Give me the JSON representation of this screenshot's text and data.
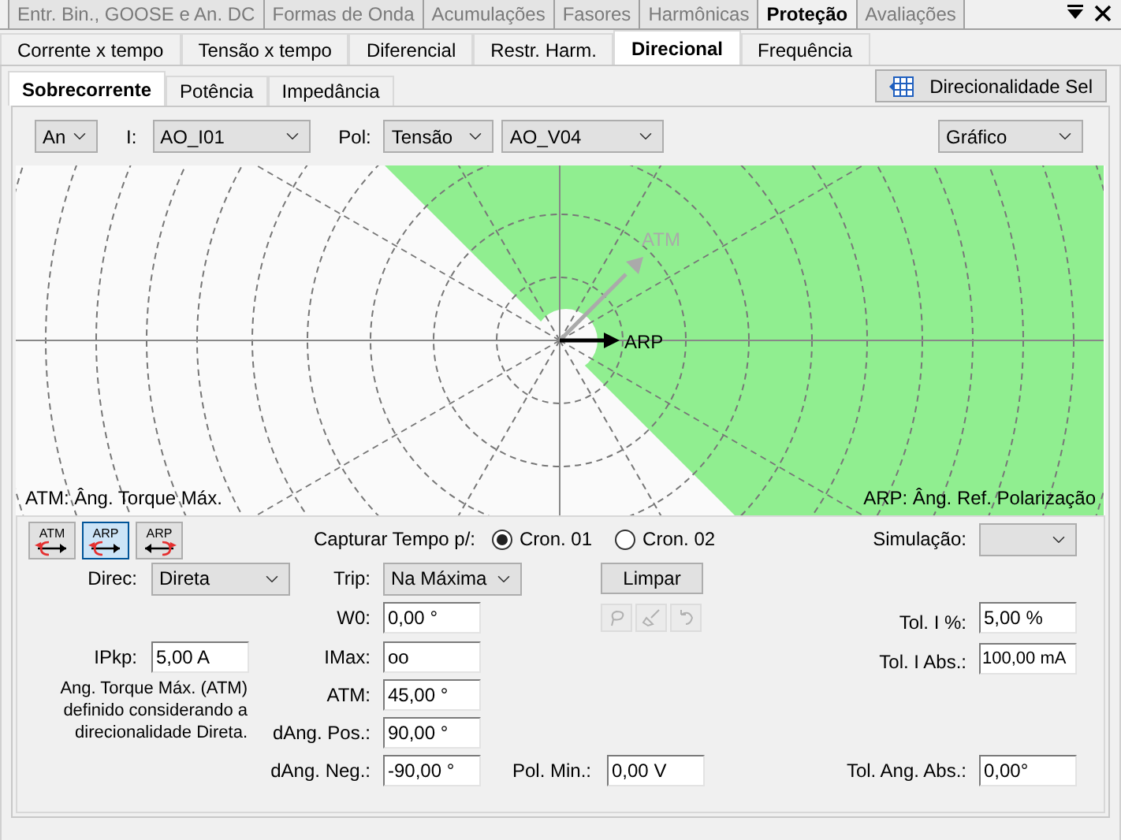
{
  "top_tabs": [
    {
      "label": "Entr. Bin., GOOSE e An. DC",
      "selected": false
    },
    {
      "label": "Formas de Onda",
      "selected": false
    },
    {
      "label": "Acumulações",
      "selected": false
    },
    {
      "label": "Fasores",
      "selected": false
    },
    {
      "label": "Harmônicas",
      "selected": false
    },
    {
      "label": "Proteção",
      "selected": true
    },
    {
      "label": "Avaliações",
      "selected": false
    }
  ],
  "module_tabs": [
    {
      "label": "Corrente x tempo",
      "selected": false
    },
    {
      "label": "Tensão x tempo",
      "selected": false
    },
    {
      "label": "Diferencial",
      "selected": false
    },
    {
      "label": "Restr. Harm.",
      "selected": false
    },
    {
      "label": "Direcional",
      "selected": true
    },
    {
      "label": "Frequência",
      "selected": false
    }
  ],
  "sub_tabs": [
    {
      "label": "Sobrecorrente",
      "selected": true
    },
    {
      "label": "Potência",
      "selected": false
    },
    {
      "label": "Impedância",
      "selected": false
    }
  ],
  "action_button": {
    "label": "Direcionalidade Sel"
  },
  "selectors": {
    "phase": "An",
    "current_label": "I:",
    "current": "AO_I01",
    "pol_label": "Pol:",
    "pol_type": "Tensão",
    "pol_channel": "AO_V04",
    "view": "Gráfico"
  },
  "chart": {
    "atm_arrow_label": "ATM",
    "arp_arrow_label": "ARP",
    "legend_left": "ATM: Âng. Torque Máx.",
    "legend_right": "ARP: Âng. Ref. Polarização"
  },
  "mode_buttons": [
    {
      "label": "ATM",
      "kind": "forward",
      "selected": false
    },
    {
      "label": "ARP",
      "kind": "forward",
      "selected": true
    },
    {
      "label": "ARP",
      "kind": "reverse",
      "selected": false
    }
  ],
  "capture": {
    "label": "Capturar Tempo p/:",
    "options": [
      {
        "label": "Cron. 01",
        "selected": true
      },
      {
        "label": "Cron. 02",
        "selected": false
      }
    ]
  },
  "simulation": {
    "label": "Simulação:"
  },
  "clear_button": {
    "label": "Limpar"
  },
  "tools": {
    "disabled": true
  },
  "settings": {
    "direc": {
      "label": "Direc:",
      "value": "Direta"
    },
    "trip": {
      "label": "Trip:",
      "value": "Na Máxima"
    },
    "w0": {
      "label": "W0:",
      "value": "0,00 °"
    },
    "ipkp": {
      "label": "IPkp:",
      "value": "5,00 A"
    },
    "imax": {
      "label": "IMax:",
      "value": "oo"
    },
    "atm": {
      "label": "ATM:",
      "value": "45,00 °"
    },
    "dang_pos": {
      "label": "dAng. Pos.:",
      "value": "90,00 °"
    },
    "dang_neg": {
      "label": "dAng. Neg.:",
      "value": "-90,00 °"
    },
    "pol_min": {
      "label": "Pol. Min.:",
      "value": "0,00 V"
    },
    "tol_i_pct": {
      "label": "Tol. I %:",
      "value": "5,00 %"
    },
    "tol_i_abs": {
      "label": "Tol. I Abs.:",
      "value": "100,00 mA"
    },
    "tol_ang_abs": {
      "label": "Tol. Ang. Abs.:",
      "value": "0,00°"
    }
  },
  "note": "Ang. Torque Máx. (ATM) definido considerando a direcionalidade Direta."
}
